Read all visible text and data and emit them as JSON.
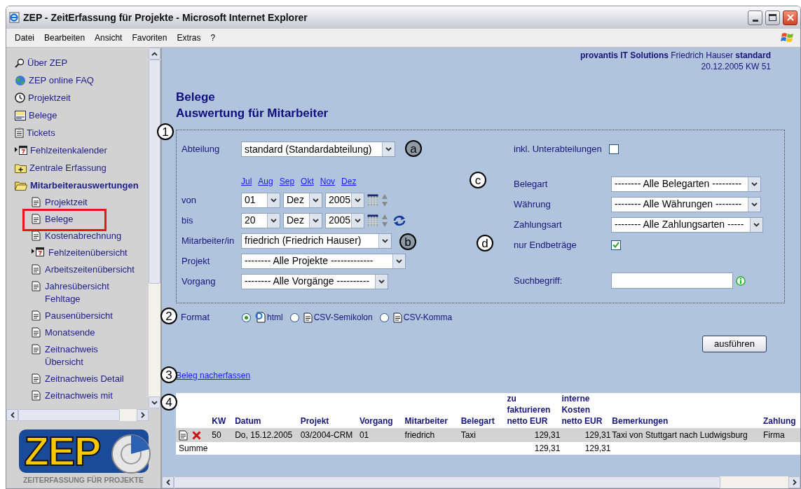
{
  "window": {
    "title": "ZEP - ZeitErfassung für Projekte - Microsoft Internet Explorer"
  },
  "menu": [
    {
      "label": "Datei"
    },
    {
      "label": "Bearbeiten"
    },
    {
      "label": "Ansicht"
    },
    {
      "label": "Favoriten"
    },
    {
      "label": "Extras"
    },
    {
      "label": "?"
    }
  ],
  "sidebar": {
    "items": [
      {
        "label": "Über ZEP",
        "kind": "search",
        "expanded": false
      },
      {
        "label": "ZEP online FAQ",
        "kind": "globe",
        "expanded": false
      },
      {
        "label": "Projektzeit",
        "kind": "clock",
        "expanded": false
      },
      {
        "label": "Belege",
        "kind": "receipt",
        "expanded": false
      },
      {
        "label": "Tickets",
        "kind": "ticket",
        "expanded": false
      },
      {
        "label": "Fehlzeitenkalender",
        "kind": "calendar",
        "expanded": false
      },
      {
        "label": "Zentrale Erfassung",
        "kind": "folder-plus",
        "expanded": false
      },
      {
        "label": "Mitarbeiterauswertungen",
        "kind": "folder-open",
        "expanded": true,
        "children": [
          {
            "label": "Projektzeit",
            "kind": "document",
            "highlighted": false
          },
          {
            "label": "Belege",
            "kind": "document",
            "highlighted": true
          },
          {
            "label": "Kostenabrechnung",
            "kind": "document",
            "highlighted": false
          },
          {
            "label": "Fehlzeitenübersicht",
            "kind": "calendar",
            "highlighted": false
          },
          {
            "label": "Arbeitszeitenübersicht",
            "kind": "document",
            "highlighted": false
          },
          {
            "label": "Jahresübersicht Fehltage",
            "kind": "document",
            "highlighted": false
          },
          {
            "label": "Pausenübersicht",
            "kind": "document",
            "highlighted": false
          },
          {
            "label": "Monatsende",
            "kind": "document",
            "highlighted": false
          },
          {
            "label": "Zeitnachweis Übersicht",
            "kind": "document",
            "highlighted": false
          },
          {
            "label": "Zeitnachweis Detail",
            "kind": "document",
            "highlighted": false
          },
          {
            "label": "Zeitnachweis mit",
            "kind": "document",
            "highlighted": false
          }
        ]
      }
    ]
  },
  "logo": {
    "text": "ZEP",
    "tagline": "ZEITERFASSUNG FÜR PROJEKTE"
  },
  "header": {
    "company": "provantis IT Solutions",
    "user": "Friedrich Hauser",
    "department": "standard",
    "date": "20.12.2005 KW 51"
  },
  "title": {
    "line1": "Belege",
    "line2": "Auswertung für Mitarbeiter"
  },
  "form": {
    "abteilung": {
      "label": "Abteilung",
      "value": "standard (Standardabteilung)"
    },
    "inkl": {
      "label": "inkl. Unterabteilungen",
      "checked": false
    },
    "months": [
      "Jul",
      "Aug",
      "Sep",
      "Okt",
      "Nov",
      "Dez"
    ],
    "von": {
      "label": "von",
      "day": "01",
      "month": "Dez",
      "year": "2005"
    },
    "bis": {
      "label": "bis",
      "day": "20",
      "month": "Dez",
      "year": "2005"
    },
    "mitarbeiter": {
      "label": "Mitarbeiter/in",
      "value": "friedrich (Friedrich Hauser)"
    },
    "projekt": {
      "label": "Projekt",
      "value": "-------- Alle Projekte -------------"
    },
    "vorgang": {
      "label": "Vorgang",
      "value": "-------- Alle Vorgänge ----------"
    },
    "belegart": {
      "label": "Belegart",
      "value": "-------- Alle Belegarten ---------"
    },
    "waehrung": {
      "label": "Währung",
      "value": "-------- Alle Währungen --------"
    },
    "zahlungsart": {
      "label": "Zahlungsart",
      "value": "-------- Alle Zahlungsarten -----"
    },
    "endbetraege": {
      "label": "nur Endbeträge",
      "checked": true
    },
    "suchbegriff": {
      "label": "Suchbegriff:"
    }
  },
  "format": {
    "label": "Format",
    "options": [
      {
        "label": "html",
        "kind": "html",
        "selected": true
      },
      {
        "label": "CSV-Semikolon",
        "kind": "csv",
        "selected": false
      },
      {
        "label": "CSV-Komma",
        "kind": "csv",
        "selected": false
      }
    ]
  },
  "run_button": "ausführen",
  "link": "Beleg nacherfassen",
  "table": {
    "columns": [
      "KW",
      "Datum",
      "Projekt",
      "Vorgang",
      "Mitarbeiter",
      "Belegart",
      "zu fakturieren netto EUR",
      "interne Kosten netto EUR",
      "Bemerkungen",
      "Zahlung"
    ],
    "rows": [
      {
        "cells": [
          "50",
          "Do, 15.12.2005",
          "03/2004-CRM",
          "01",
          "friedrich",
          "Taxi",
          "129,31",
          "129,31",
          "Taxi von Stuttgart nach Ludwigsburg",
          "Firma"
        ]
      }
    ],
    "sum": {
      "label": "Summe",
      "fakturieren": "129,31",
      "kosten": "129,31"
    }
  },
  "annotations": [
    {
      "label": "1",
      "kind": "plain"
    },
    {
      "label": "a",
      "kind": "shaded"
    },
    {
      "label": "c",
      "kind": "plain"
    },
    {
      "label": "b",
      "kind": "shaded"
    },
    {
      "label": "d",
      "kind": "plain"
    },
    {
      "label": "2",
      "kind": "plain"
    },
    {
      "label": "3",
      "kind": "plain"
    },
    {
      "label": "4",
      "kind": "plain"
    }
  ]
}
